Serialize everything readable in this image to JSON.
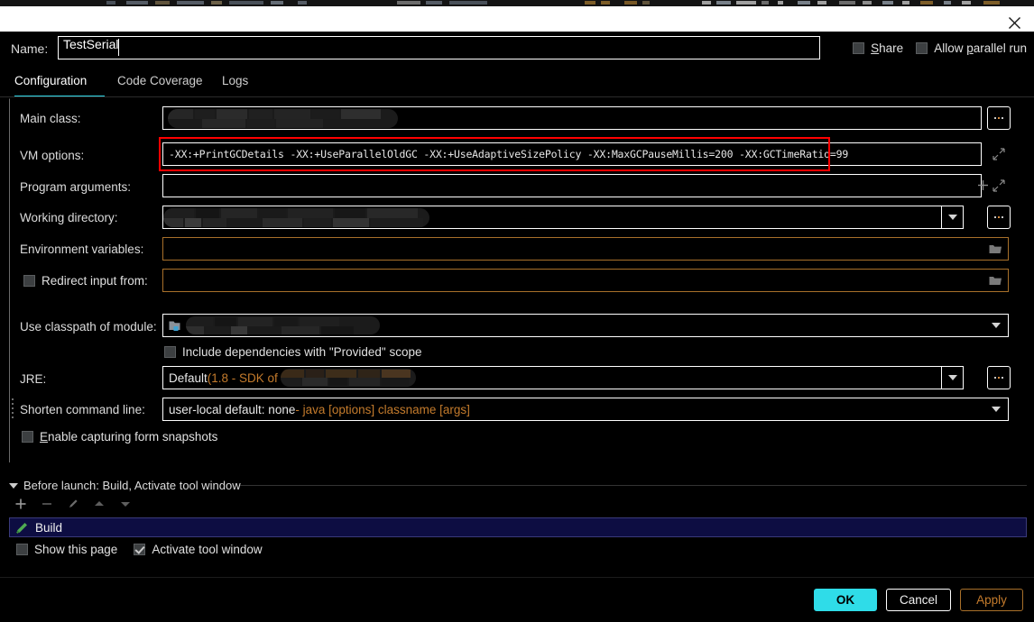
{
  "window": {
    "close_label": "close",
    "name_label": "Name:",
    "name_value": "TestSerial"
  },
  "header_options": [
    {
      "label": "Share",
      "mnemonic": "S",
      "checked": false,
      "name": "share"
    },
    {
      "label": "Allow parallel run",
      "mnemonic": "p",
      "checked": false,
      "name": "allow-parallel-run"
    }
  ],
  "tabs": [
    {
      "label": "Configuration",
      "active": true
    },
    {
      "label": "Code Coverage",
      "active": false
    },
    {
      "label": "Logs",
      "active": false
    }
  ],
  "fields": {
    "main_class": {
      "label": "Main class:",
      "value": "",
      "browse_label": "..."
    },
    "vm_options": {
      "label": "VM options:",
      "value": "-XX:+PrintGCDetails -XX:+UseParallelOldGC -XX:+UseAdaptiveSizePolicy -XX:MaxGCPauseMillis=200 -XX:GCTimeRatio=99"
    },
    "program_arguments": {
      "label": "Program arguments:",
      "value": ""
    },
    "working_directory": {
      "label": "Working directory:",
      "value": "",
      "browse_label": "..."
    },
    "environment_variables": {
      "label": "Environment variables:",
      "value": ""
    },
    "redirect_input": {
      "label": "Redirect input from:",
      "value": "",
      "checked": false
    },
    "classpath_module": {
      "label": "Use classpath of module:",
      "value": ""
    },
    "include_provided": {
      "label": "Include dependencies with \"Provided\" scope",
      "checked": false
    },
    "jre": {
      "label": "JRE:",
      "value_main": "Default ",
      "value_hint": "(1.8 - SDK of '",
      "browse_label": "..."
    },
    "shorten_command_line": {
      "label": "Shorten command line:",
      "value_main": "user-local default: none ",
      "value_hint": "- java [options] classname [args]"
    },
    "enable_form_snapshots": {
      "label": "Enable capturing form snapshots",
      "mnemonic": "E",
      "checked": false
    }
  },
  "before_launch": {
    "title": "Before launch: Build, Activate tool window",
    "toolbar": [
      {
        "name": "add",
        "glyph": "+"
      },
      {
        "name": "remove",
        "glyph": "−"
      },
      {
        "name": "edit",
        "glyph": "pencil"
      },
      {
        "name": "move-up",
        "glyph": "up"
      },
      {
        "name": "move-down",
        "glyph": "down"
      }
    ],
    "tasks": [
      {
        "label": "Build",
        "icon": "build-hammer-icon",
        "selected": true
      }
    ],
    "options": [
      {
        "label": "Show this page",
        "checked": false,
        "name": "show-this-page"
      },
      {
        "label": "Activate tool window",
        "checked": true,
        "name": "activate-tool-window"
      }
    ]
  },
  "dialog_buttons": [
    {
      "label": "OK",
      "style": "primary",
      "name": "ok"
    },
    {
      "label": "Cancel",
      "style": "default",
      "name": "cancel"
    },
    {
      "label": "Apply",
      "style": "accent",
      "name": "apply"
    }
  ],
  "colors": {
    "accent_cyan": "#2fdce8",
    "accent_amber": "#c47b2c",
    "highlight_red": "#ff0000",
    "selection_blue": "#0d0d42",
    "background": "#000000"
  }
}
